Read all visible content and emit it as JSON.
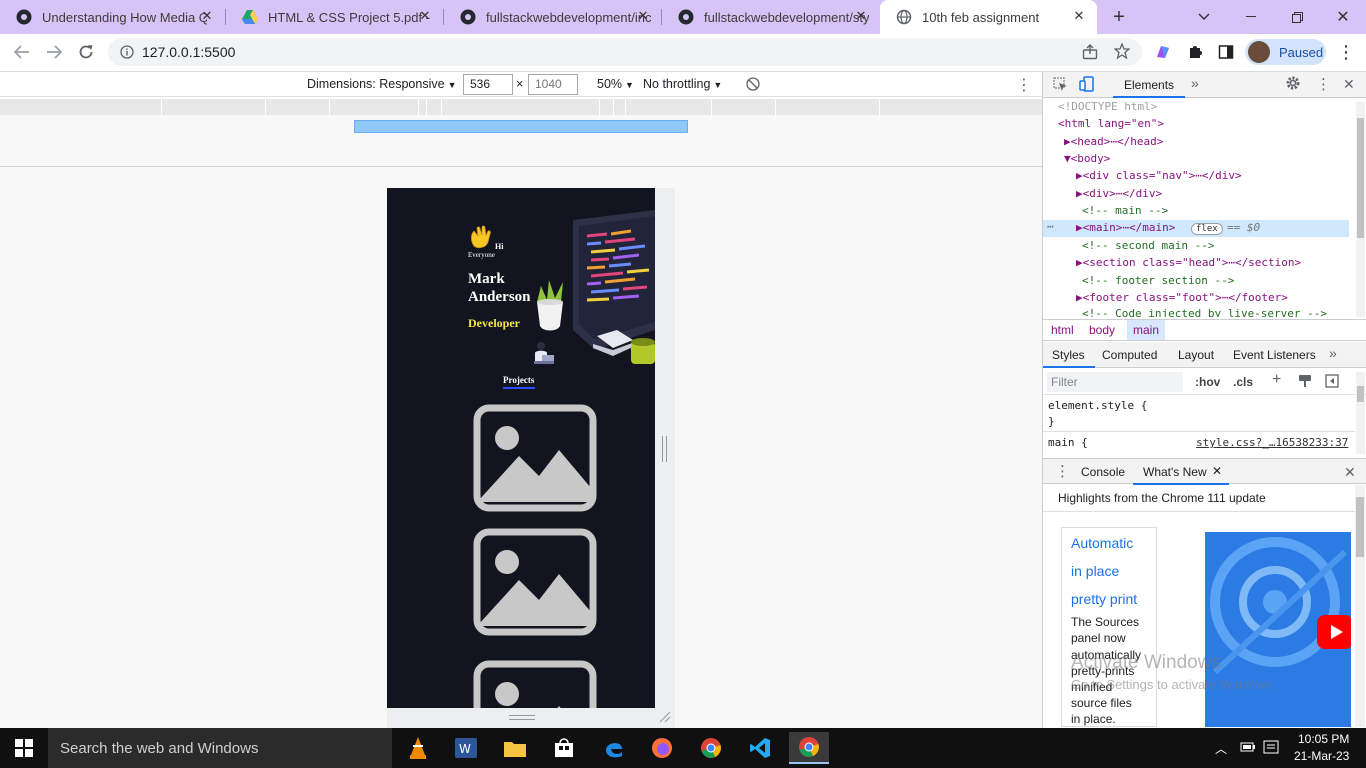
{
  "tabs": [
    {
      "title": "Understanding How Media Q",
      "icon": "github-icon",
      "active": false
    },
    {
      "title": "HTML & CSS Project 5.pdf - G",
      "icon": "google-drive-icon",
      "active": false
    },
    {
      "title": "fullstackwebdevelopment/inc",
      "icon": "github-icon",
      "active": false
    },
    {
      "title": "fullstackwebdevelopment/sty",
      "icon": "github-icon",
      "active": false
    },
    {
      "title": "10th feb assignment",
      "icon": "globe-icon",
      "active": true
    }
  ],
  "address": {
    "url": "127.0.0.1:5500"
  },
  "profile": {
    "status": "Paused"
  },
  "device_toolbar": {
    "dimensions_label": "Dimensions: Responsive",
    "width": "536",
    "times": "×",
    "height": "1040",
    "zoom": "50%",
    "throttle": "No throttling"
  },
  "page": {
    "greeting": "Hi",
    "greeting_sub": "Everyone",
    "name_first": "Mark",
    "name_last": "Anderson",
    "role": "Developer",
    "projects_heading": "Projects"
  },
  "devtools": {
    "tab_elements": "Elements",
    "dom_lines": [
      {
        "text": "<!DOCTYPE html>",
        "kind": "doctype"
      },
      {
        "text": "<html lang=\"en\">",
        "kind": "tag"
      },
      {
        "text": "▶<head>⋯</head>",
        "kind": "tag"
      },
      {
        "text": "▼<body>",
        "kind": "tag"
      },
      {
        "text": "▶<div class=\"nav\">⋯</div>",
        "kind": "tag"
      },
      {
        "text": "▶<div>⋯</div>",
        "kind": "tag"
      },
      {
        "text": "<!-- main -->",
        "kind": "comment"
      },
      {
        "text": "▶<main>⋯</main>",
        "kind": "selected",
        "badge": "flex",
        "suffix": "== $0"
      },
      {
        "text": "<!-- second main -->",
        "kind": "comment"
      },
      {
        "text": "▶<section class=\"head\">⋯</section>",
        "kind": "tag"
      },
      {
        "text": "<!-- footer section -->",
        "kind": "comment"
      },
      {
        "text": "▶<footer class=\"foot\">⋯</footer>",
        "kind": "tag"
      },
      {
        "text": "<!-- Code injected by live-server -->",
        "kind": "comment"
      }
    ],
    "breadcrumbs": [
      "html",
      "body",
      "main"
    ],
    "style_tabs": [
      "Styles",
      "Computed",
      "Layout",
      "Event Listeners"
    ],
    "filter_placeholder": "Filter",
    "hov": ":hov",
    "cls": ".cls",
    "element_style": "element.style {",
    "close_brace": "}",
    "main_rule": "main {",
    "main_source": "style.css?_…16538233:37",
    "drawer_tabs": [
      "Console",
      "What's New"
    ],
    "whats_new_title": "Highlights from the Chrome 111 update",
    "feature_link": [
      "Automatic",
      "in place",
      "pretty print"
    ],
    "feature_desc": [
      "The Sources",
      "panel now",
      "automatically",
      "pretty-prints",
      "minified",
      "source files",
      "in place."
    ],
    "watermark_title": "Activate Windows",
    "watermark_sub": "Go to Settings to activate Windows."
  },
  "taskbar": {
    "search_placeholder": "Search the web and Windows",
    "time": "10:05 PM",
    "date": "21-Mar-23"
  }
}
